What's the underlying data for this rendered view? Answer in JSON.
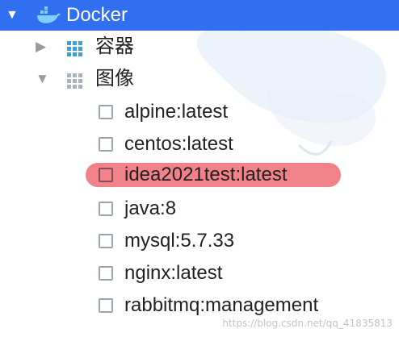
{
  "tree": {
    "root": {
      "label": "Docker",
      "expanded": true,
      "icon": "docker-whale-icon"
    },
    "groups": [
      {
        "label": "容器",
        "expanded": false,
        "icon": "grid-icon"
      },
      {
        "label": "图像",
        "expanded": true,
        "icon": "grid-icon"
      }
    ],
    "images": [
      {
        "label": "alpine:latest",
        "selected": false
      },
      {
        "label": "centos:latest",
        "selected": false
      },
      {
        "label": "idea2021test:latest",
        "selected": true
      },
      {
        "label": "java:8",
        "selected": false
      },
      {
        "label": "mysql:5.7.33",
        "selected": false
      },
      {
        "label": "nginx:latest",
        "selected": false
      },
      {
        "label": "rabbitmq:management",
        "selected": false
      }
    ]
  },
  "watermark": "https://blog.csdn.net/qq_41835813",
  "colors": {
    "header_bg": "#2f6ff0",
    "selection": "#f2828a",
    "grid_blue": "#3aa0d8"
  }
}
